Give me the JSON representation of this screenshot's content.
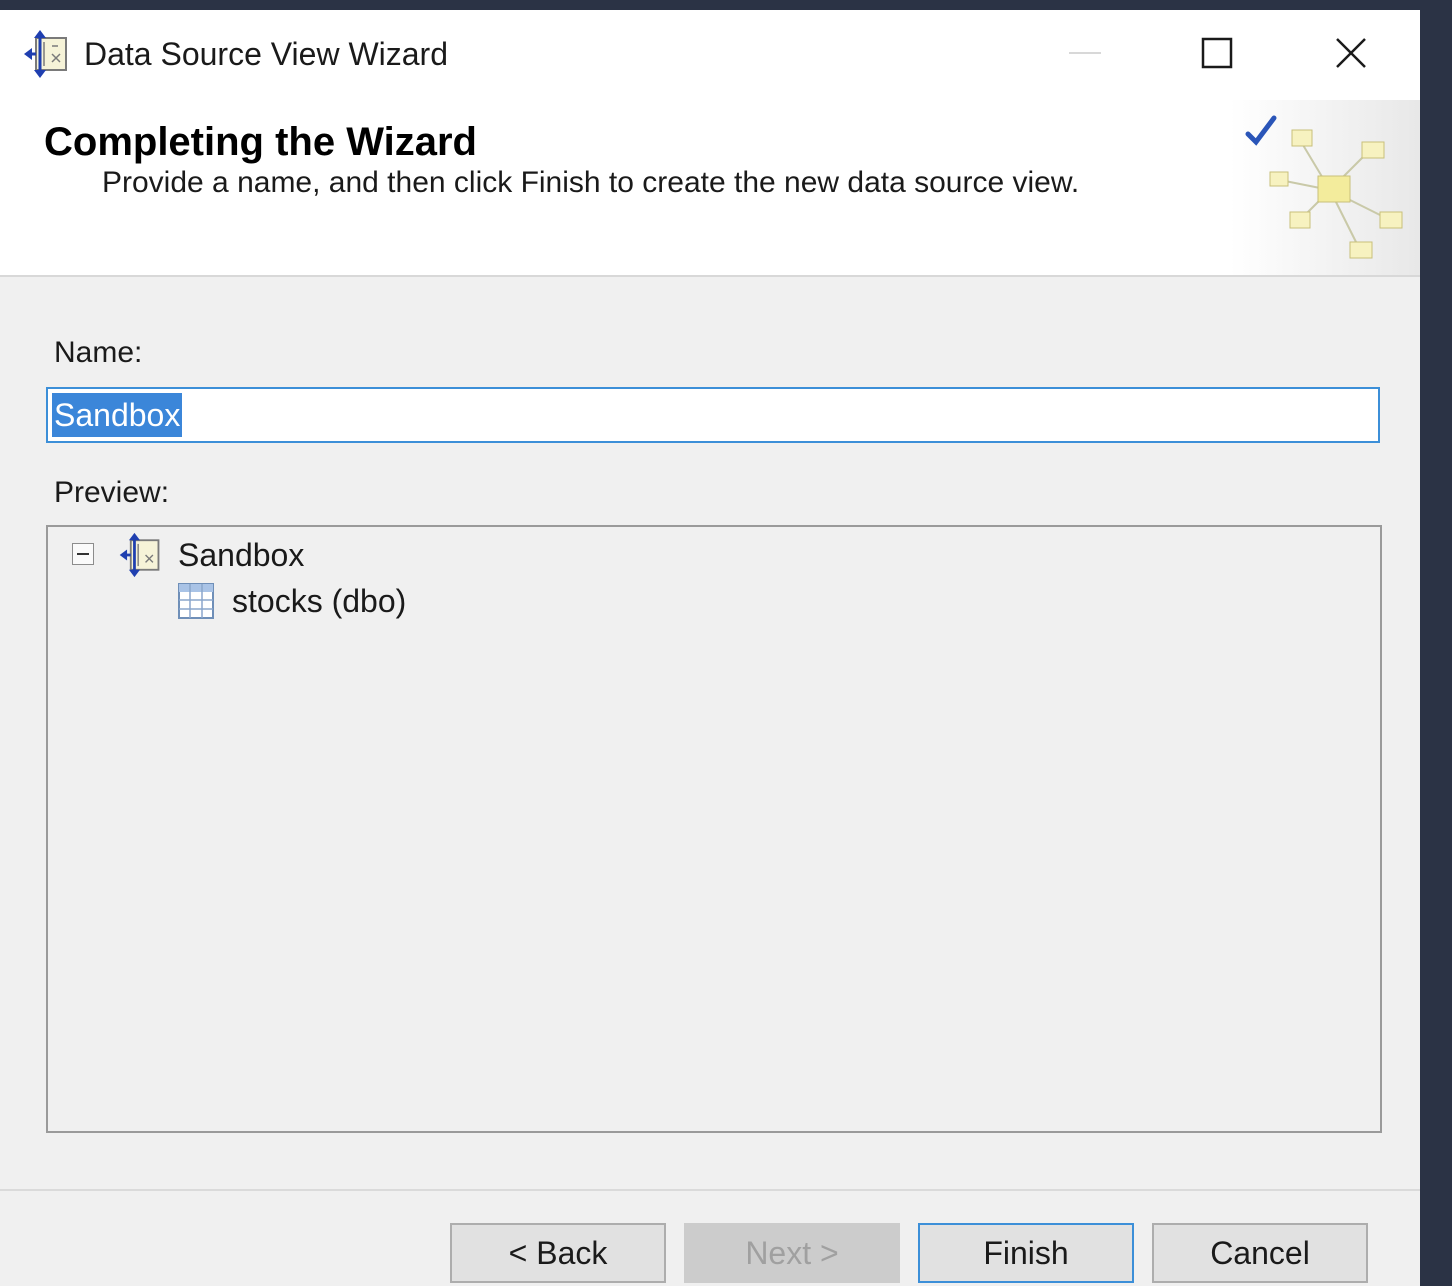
{
  "window": {
    "title": "Data Source View Wizard",
    "title_icon": "data-source-view-icon",
    "controls": {
      "minimize_icon": "minimize-icon",
      "maximize_icon": "maximize-icon",
      "close_icon": "close-icon"
    }
  },
  "header": {
    "title": "Completing the Wizard",
    "subtitle": "Provide a name, and then click Finish to create the new data source view.",
    "graphic": "wizard-graphic"
  },
  "form": {
    "name_label": "Name:",
    "name_value": "Sandbox",
    "preview_label": "Preview:"
  },
  "preview_tree": {
    "root": {
      "label": "Sandbox",
      "icon": "data-source-view-icon",
      "expanded": true
    },
    "children": [
      {
        "label": "stocks (dbo)",
        "icon": "table-icon"
      }
    ]
  },
  "footer": {
    "back_label": "< Back",
    "next_label": "Next >",
    "finish_label": "Finish",
    "cancel_label": "Cancel"
  },
  "colors": {
    "accent": "#3c8fd8",
    "selection": "#3b86d9",
    "dialog_bg": "#f0f0f0",
    "backdrop": "#2b3345"
  }
}
